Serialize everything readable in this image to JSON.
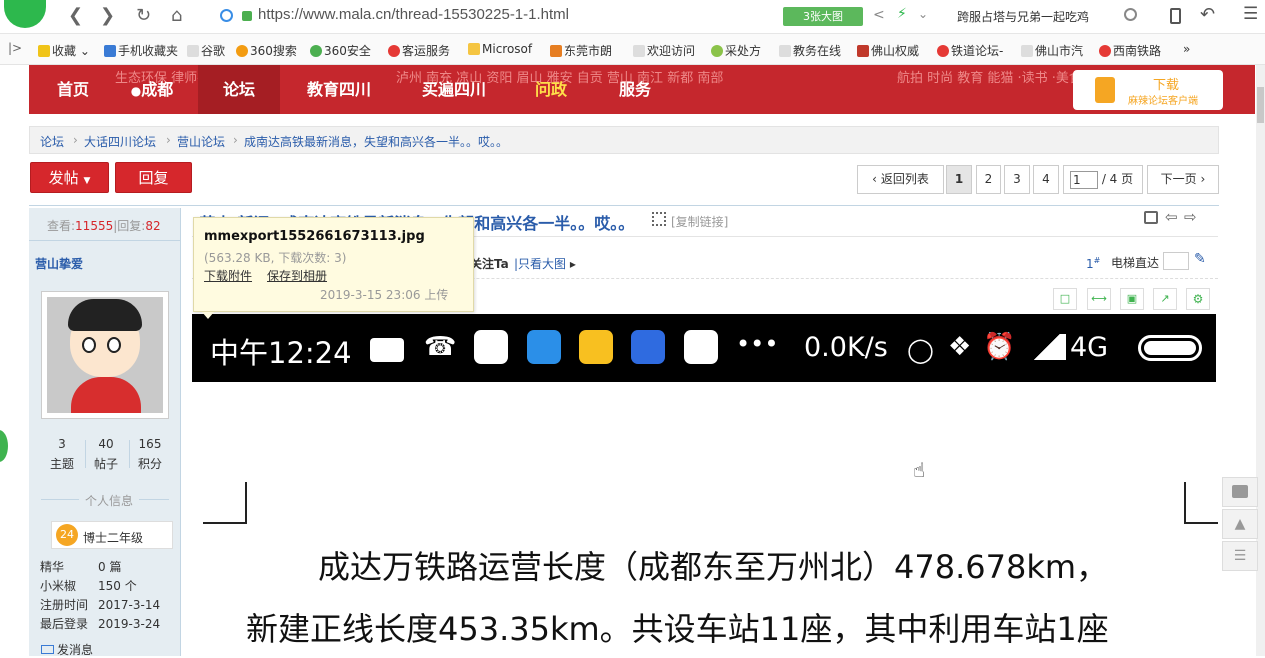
{
  "browser": {
    "url": "https://www.mala.cn/thread-15530225-1-1.html",
    "big_image_btn": "3张大图",
    "search_hint": "跨服占塔与兄弟一起吃鸡",
    "bookmarks": [
      "收藏",
      "手机收藏夹",
      "谷歌",
      "360搜索",
      "360安全",
      "客运服务",
      "Microsof",
      "东莞市朗",
      "欢迎访问",
      "采处方",
      "教务在线",
      "佛山权威",
      "铁道论坛-",
      "佛山市汽",
      "西南铁路"
    ],
    "bookmark_colors": [
      "#f0c419",
      "#3a7bd5",
      "#ddd",
      "#f39c12",
      "#4caf50",
      "#e53935",
      "#f5c542",
      "#e67e22",
      "#ddd",
      "#8bc34a",
      "#ddd",
      "#c0392b",
      "#e53935",
      "#ddd",
      "#e53935"
    ]
  },
  "nav": {
    "items": [
      "首页",
      "成都",
      "论坛",
      "教育四川",
      "买遍四川",
      "问政",
      "服务"
    ],
    "faded_left": "生态环保  律师在线  舆情监测",
    "faded_mid": "泸州  南充  凉山  资阳  眉山  雅安  自贡  营山  南江  新都  南部",
    "faded_right": "航拍  时尚  教育  能猫  ·读书  ·美食  ·宗教",
    "download_title": "下载",
    "download_sub": "麻辣论坛客户端"
  },
  "breadcrumb": [
    "论坛",
    "大话四川论坛",
    "营山论坛",
    "成南达高铁最新消息，失望和高兴各一半。。哎。。"
  ],
  "actions": {
    "post": "发帖",
    "reply": "回复"
  },
  "pager": {
    "back": "返回列表",
    "pages": [
      "1",
      "2",
      "3",
      "4"
    ],
    "current": "1",
    "input": "1",
    "total": "/ 4 页",
    "next": "下一页"
  },
  "sidebar": {
    "views_label": "查看:",
    "views": "11555",
    "replies_label": "回复:",
    "replies": "82",
    "username": "营山挚爱",
    "stats": [
      {
        "value": "3",
        "label": "主题"
      },
      {
        "value": "40",
        "label": "帖子"
      },
      {
        "value": "165",
        "label": "积分"
      }
    ],
    "info_title": "个人信息",
    "level_num": "24",
    "level": "博士二年级",
    "details": [
      {
        "k": "精华",
        "v": "0 篇"
      },
      {
        "k": "小米椒",
        "v": "150 个"
      },
      {
        "k": "注册时间",
        "v": "2017-3-14"
      },
      {
        "k": "最后登录",
        "v": "2019-3-24"
      }
    ],
    "message": "发消息"
  },
  "post": {
    "title": "[营山·新闻] 成南达高铁最新消息，失望和高兴各一半。。哎。。",
    "qr_link": "[复制链接]",
    "follow": "关注Ta",
    "only_big": "只看大图",
    "floor": "1",
    "elevator": "电梯直达"
  },
  "tooltip": {
    "filename": "mmexport1552661673113.jpg",
    "meta": "(563.28 KB, 下载次数: 3)",
    "download": "下载附件",
    "save": "保存到相册",
    "date": "2019-3-15 23:06 上传"
  },
  "image": {
    "time": "中午12:24",
    "speed": "0.0K/s",
    "network": "4G",
    "line1": "成达万铁路运营长度（成都东至万州北）478.678km，",
    "line2": "新建正线长度453.35km。共设车站11座，其中利用车站1座"
  }
}
